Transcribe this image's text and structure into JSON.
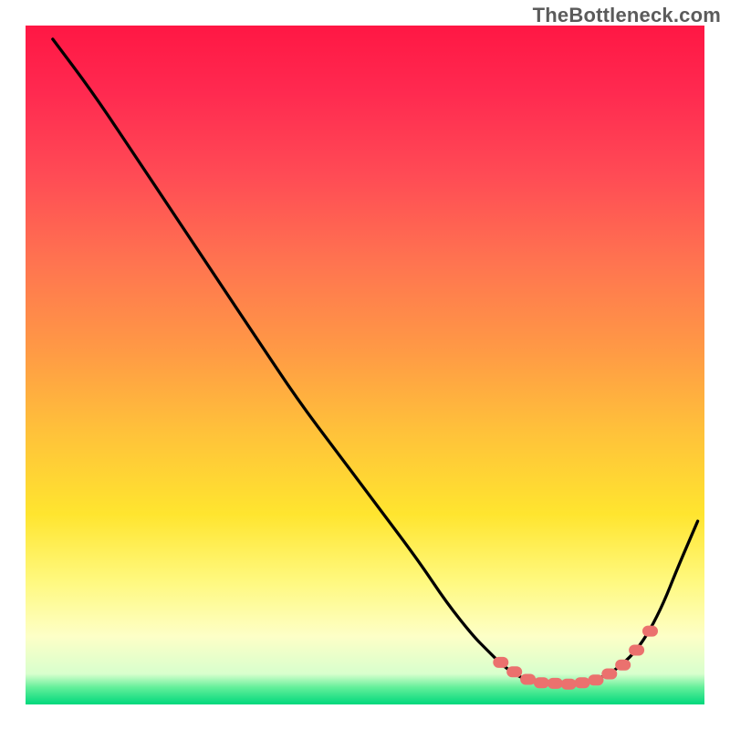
{
  "watermark": "TheBottleneck.com",
  "colors": {
    "curve_stroke": "#000000",
    "marker_fill": "#eb716e",
    "marker_stroke": "#eb716e",
    "gradient_stops": [
      {
        "offset": 0.0,
        "color": "#ff1744"
      },
      {
        "offset": 0.1,
        "color": "#ff2a50"
      },
      {
        "offset": 0.22,
        "color": "#ff4b55"
      },
      {
        "offset": 0.35,
        "color": "#ff7450"
      },
      {
        "offset": 0.48,
        "color": "#ff9a45"
      },
      {
        "offset": 0.6,
        "color": "#ffc23a"
      },
      {
        "offset": 0.72,
        "color": "#ffe52f"
      },
      {
        "offset": 0.82,
        "color": "#fff980"
      },
      {
        "offset": 0.9,
        "color": "#fdffc7"
      },
      {
        "offset": 0.955,
        "color": "#d8ffcd"
      },
      {
        "offset": 0.975,
        "color": "#63ef9a"
      },
      {
        "offset": 1.0,
        "color": "#00d87c"
      }
    ]
  },
  "chart_data": {
    "type": "line",
    "title": "",
    "xlabel": "",
    "ylabel": "",
    "xlim": [
      0,
      100
    ],
    "ylim": [
      0,
      100
    ],
    "notes": "Image is an axis-free bottleneck curve over a vertical red→green gradient. X and Y values are estimated as percentages of the 800×800 plot area, with Y increasing upward (curve height ≈ bottleneck %).",
    "series": [
      {
        "name": "bottleneck-curve",
        "x": [
          4,
          10,
          16,
          22,
          28,
          34,
          40,
          46,
          52,
          58,
          62,
          66,
          68,
          70,
          72,
          74,
          76,
          78,
          80,
          82,
          84,
          86,
          88,
          90,
          92,
          94,
          96,
          99
        ],
        "y": [
          98,
          90,
          81,
          72,
          63,
          54,
          45,
          37,
          29,
          21,
          15,
          10,
          8,
          6,
          4.5,
          3.5,
          3,
          3,
          3,
          3.2,
          3.7,
          4.5,
          6,
          8,
          11,
          15,
          20,
          27
        ]
      }
    ],
    "markers": {
      "name": "highlighted-points",
      "note": "Pink rounded markers clustered near the curve minimum",
      "x": [
        70,
        72,
        74,
        76,
        78,
        80,
        82,
        84,
        86,
        88,
        90,
        92
      ],
      "y": [
        6.2,
        4.8,
        3.7,
        3.2,
        3.1,
        3.0,
        3.2,
        3.6,
        4.5,
        5.8,
        8.0,
        10.8
      ]
    }
  }
}
